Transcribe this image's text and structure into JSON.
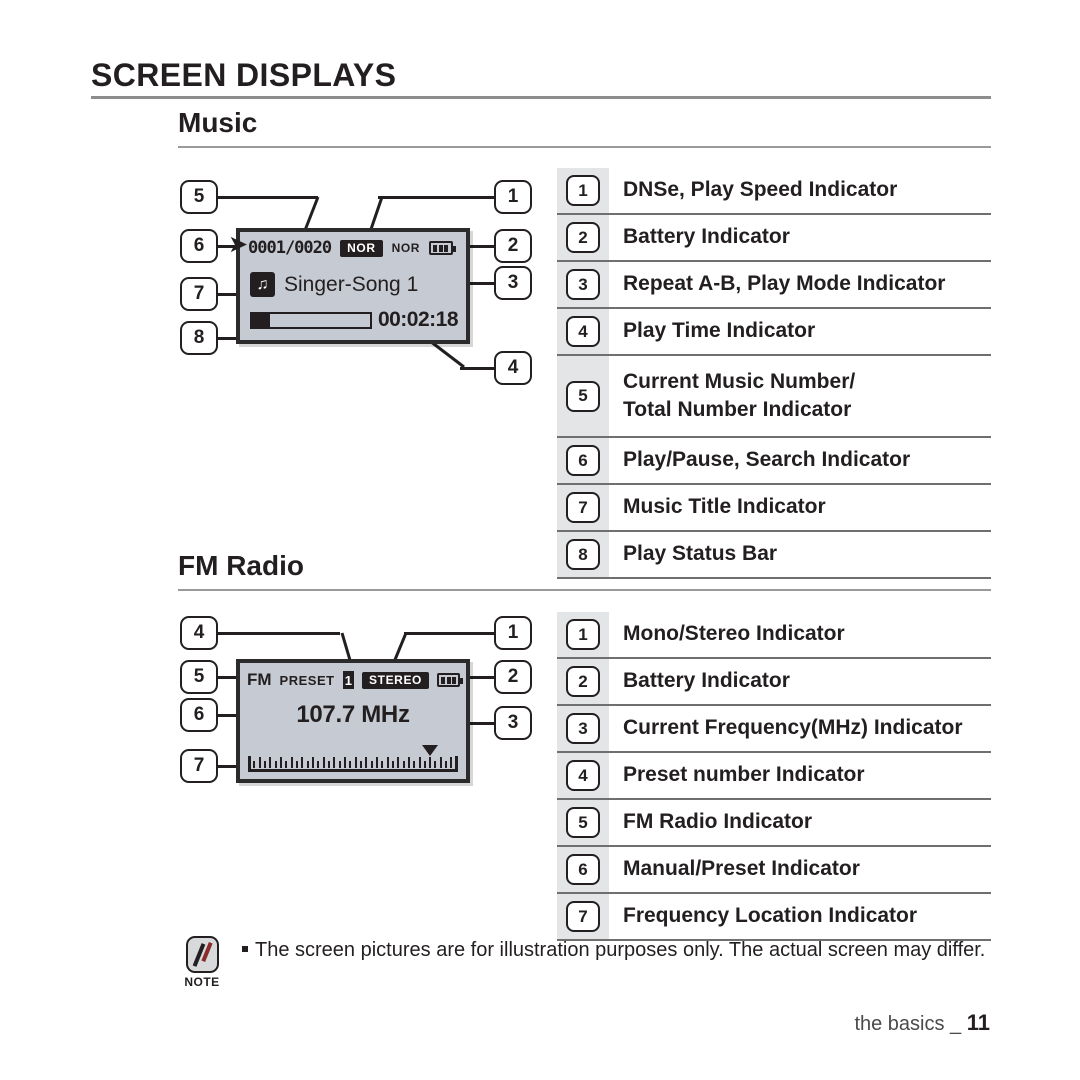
{
  "chapter": {
    "title": "SCREEN DISPLAYS"
  },
  "sections": {
    "music": {
      "heading": "Music"
    },
    "fm": {
      "heading": "FM Radio"
    }
  },
  "music_screen": {
    "track_number": "0001/0020",
    "dnse_badge": "NOR",
    "play_mode": "NOR",
    "battery_icon": "battery-full-icon",
    "play_indicator_icon": "play-arrow-icon",
    "music_note_icon": "music-note-icon",
    "song_title": "Singer-Song 1",
    "play_time": "00:02:18",
    "progress_percent": 15,
    "callouts_left": [
      "5",
      "6",
      "7",
      "8"
    ],
    "callouts_right": [
      "1",
      "2",
      "3",
      "4"
    ]
  },
  "fm_screen": {
    "fm_label": "FM",
    "preset_word": "PRESET",
    "preset_number": "1",
    "stereo_badge": "STEREO",
    "battery_icon": "battery-full-icon",
    "frequency": "107.7 MHz",
    "marker_icon": "frequency-marker-triangle-icon",
    "callouts_left": [
      "4",
      "5",
      "6",
      "7"
    ],
    "callouts_right": [
      "1",
      "2",
      "3"
    ]
  },
  "music_legend": [
    {
      "num": "1",
      "lines": [
        "DNSe, Play Speed Indicator"
      ]
    },
    {
      "num": "2",
      "lines": [
        "Battery Indicator"
      ]
    },
    {
      "num": "3",
      "lines": [
        "Repeat A-B, Play Mode Indicator"
      ]
    },
    {
      "num": "4",
      "lines": [
        "Play Time Indicator"
      ]
    },
    {
      "num": "5",
      "lines": [
        "Current Music Number/",
        "Total Number Indicator"
      ]
    },
    {
      "num": "6",
      "lines": [
        "Play/Pause, Search Indicator"
      ]
    },
    {
      "num": "7",
      "lines": [
        "Music Title Indicator"
      ]
    },
    {
      "num": "8",
      "lines": [
        "Play Status Bar"
      ]
    }
  ],
  "fm_legend": [
    {
      "num": "1",
      "lines": [
        "Mono/Stereo Indicator"
      ]
    },
    {
      "num": "2",
      "lines": [
        "Battery Indicator"
      ]
    },
    {
      "num": "3",
      "lines": [
        "Current Frequency(MHz) Indicator"
      ]
    },
    {
      "num": "4",
      "lines": [
        "Preset number Indicator"
      ]
    },
    {
      "num": "5",
      "lines": [
        "FM Radio Indicator"
      ]
    },
    {
      "num": "6",
      "lines": [
        "Manual/Preset Indicator"
      ]
    },
    {
      "num": "7",
      "lines": [
        "Frequency Location Indicator"
      ]
    }
  ],
  "note": {
    "badge_label": "NOTE",
    "icon": "note-pencil-icon",
    "text": "The screen pictures are for illustration purposes only. The actual screen may differ."
  },
  "footer": {
    "label": "the basics _",
    "page": "11"
  },
  "colors": {
    "ink": "#231f20",
    "lcd_background": "#c6cad2",
    "legend_band": "#e3e5e7",
    "rule": "#8d8d8d"
  }
}
